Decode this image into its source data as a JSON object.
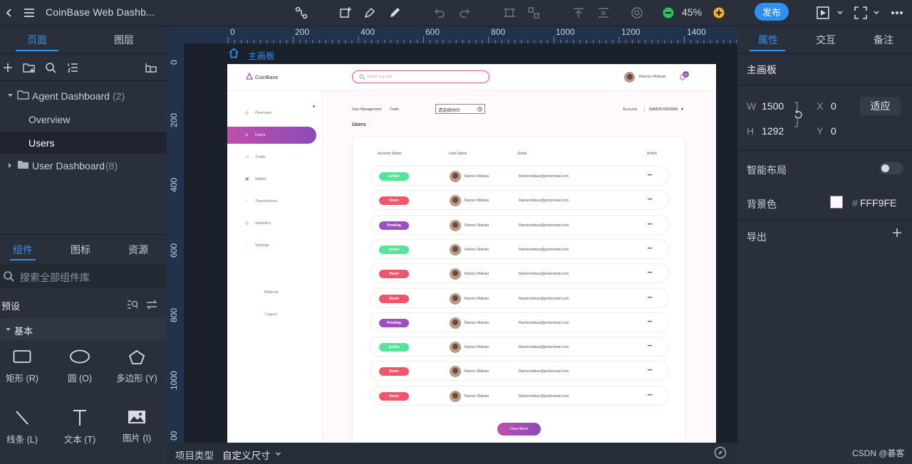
{
  "app": {
    "title": "CoinBase Web Dashb...",
    "zoom": "45%",
    "publish": "发布"
  },
  "left_panel": {
    "tabs": [
      "页面",
      "图层"
    ],
    "tree": [
      {
        "label": "Agent Dashboard",
        "count": "(2)"
      },
      {
        "label": "Overview"
      },
      {
        "label": "Users"
      },
      {
        "label": "User Dashboard",
        "count": "(8)"
      }
    ],
    "lib_tabs": [
      "组件",
      "图标",
      "资源"
    ],
    "search_placeholder": "搜索全部组件库",
    "preset": "预设",
    "basic": "基本",
    "components": [
      "矩形 (R)",
      "圆 (O)",
      "多边形 (Y)",
      "线条 (L)",
      "文本 (T)",
      "图片 (I)"
    ]
  },
  "canvas": {
    "ruler_h": [
      "0",
      "200",
      "400",
      "600",
      "800",
      "1000",
      "1200",
      "1400"
    ],
    "ruler_v": [
      "0",
      "200",
      "400",
      "600",
      "800",
      "1000",
      "00"
    ],
    "artboard_label": "主画板",
    "project_type_label": "项目类型",
    "project_type_value": "自定义尺寸"
  },
  "mockup": {
    "logo": "CoinBase",
    "search_placeholder": "Search e.g card",
    "user_name": "Ramon Ridwan",
    "notif_count": "24",
    "sidebar": [
      "Overview",
      "Users",
      "Trade",
      "Wallet",
      "Transactions",
      "Statistics",
      "Settings"
    ],
    "referral": "Referral",
    "logout": "Logout",
    "breadcrumb_1": "User Management",
    "breadcrumb_2": "Trade",
    "date_placeholder": "请选择时间",
    "accounts": "Accounts",
    "account_user": "RAMON RIDWAN",
    "section_title": "Users",
    "columns": [
      "Account Status",
      "User Name",
      "Email",
      "Action"
    ],
    "rows": [
      {
        "status": "Active",
        "name": "Ramon Ridwan",
        "email": "Ramonridwan@protonmail.com"
      },
      {
        "status": "Down",
        "name": "Ramon Ridwan",
        "email": "Ramonridwan@protonmail.com"
      },
      {
        "status": "Pending",
        "name": "Ramon Ridwan",
        "email": "Ramonridwan@protonmail.com"
      },
      {
        "status": "Active",
        "name": "Ramon Ridwan",
        "email": "Ramonridwan@protonmail.com"
      },
      {
        "status": "Down",
        "name": "Ramon Ridwan",
        "email": "Ramonridwan@protonmail.com"
      },
      {
        "status": "Down",
        "name": "Ramon Ridwan",
        "email": "Ramonridwan@protonmail.com"
      },
      {
        "status": "Pending",
        "name": "Ramon Ridwan",
        "email": "Ramonridwan@protonmail.com"
      },
      {
        "status": "Active",
        "name": "Ramon Ridwan",
        "email": "Ramonridwan@protonmail.com"
      },
      {
        "status": "Down",
        "name": "Ramon Ridwan",
        "email": "Ramonridwan@protonmail.com"
      },
      {
        "status": "Down",
        "name": "Ramon Ridwan",
        "email": "Ramonridwan@protonmail.com"
      }
    ],
    "action_glyph": "•••",
    "view_more": "View More",
    "status_colors": {
      "Active": "#56e39a",
      "Down": "#f0556a",
      "Pending": "#9b4fc0"
    }
  },
  "right_panel": {
    "tabs": [
      "属性",
      "交互",
      "备注"
    ],
    "title": "主画板",
    "w_label": "W",
    "w_value": "1500",
    "h_label": "H",
    "h_value": "1292",
    "x_label": "X",
    "x_value": "0",
    "y_label": "Y",
    "y_value": "0",
    "fit": "适应",
    "smart_layout": "智能布局",
    "bg_label": "背景色",
    "bg_hash": "#",
    "bg_value": "FFF9FE",
    "export": "导出"
  },
  "watermark": "CSDN @碁客",
  "colors": {
    "accent": "#2f8ff2",
    "brand_purple": "#9b4fc0"
  }
}
